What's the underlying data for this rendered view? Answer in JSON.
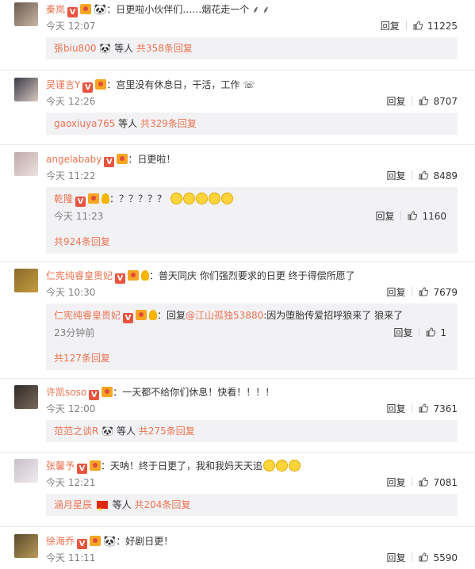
{
  "labels": {
    "today": "今天",
    "reply": "回复",
    "etc": "等人",
    "total_prefix": "共",
    "reply_suffix": "条回复"
  },
  "comments": [
    {
      "name": "秦岚",
      "text": "日更啦小伙伴们……烟花走一个",
      "time": "今天 12:07",
      "likes": "11225",
      "sub_user": "張biu800",
      "sub_count": "共358条回复"
    },
    {
      "name": "吴谨言Y",
      "text": "宫里没有休息日，干活，工作",
      "time": "今天 12:26",
      "likes": "8707",
      "sub_user": "gaoxiuya765",
      "sub_count": "共329条回复"
    },
    {
      "name": "angelababy",
      "text": "日更啦！",
      "time": "今天 11:22",
      "likes": "8489",
      "reply_name": "乾隆",
      "reply_text": "？？？？？",
      "reply_time": "今天 11:23",
      "reply_likes": "1160",
      "reply_footer": "共924条回复"
    },
    {
      "name": "仁宪纯睿皇贵妃",
      "text": "普天同庆 你们强烈要求的日更 终于得偿所愿了",
      "time": "今天 10:30",
      "likes": "7679",
      "reply_name": "仁宪纯睿皇贵妃",
      "reply_prefix": "回复",
      "reply_at": "@江山孤独53880",
      "reply_text": ":因为堕胎传爱招呼狼来了 狼来了",
      "reply_time": "23分钟前",
      "reply_likes": "1",
      "reply_footer": "共127条回复"
    },
    {
      "name": "许凯soso",
      "text": "一天都不给你们休息！快看！！！！",
      "time": "今天 12:00",
      "likes": "7361",
      "sub_user": "范范之谈R",
      "sub_count": "共275条回复"
    },
    {
      "name": "张馨予",
      "text": "天呐！终于日更了，我和我妈天天追",
      "time": "今天 12:21",
      "likes": "7081",
      "sub_user": "涵月星辰",
      "sub_count": "共204条回复"
    },
    {
      "name": "徐海乔",
      "text": "好剧日更！",
      "time": "今天 11:11",
      "likes": "5590"
    }
  ],
  "colors": {
    "link": "#eb7350",
    "time": "#808080",
    "sub_bg": "#f2f2f5"
  }
}
